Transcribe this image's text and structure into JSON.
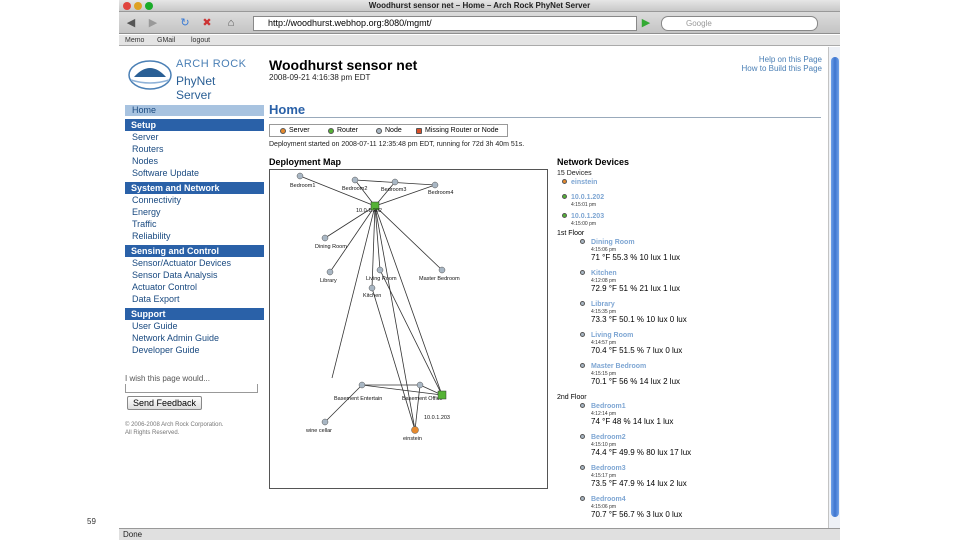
{
  "window": {
    "title": "Woodhurst sensor net – Home – Arch Rock PhyNet Server"
  },
  "toolbar": {
    "url": "http://woodhurst.webhop.org:8080/mgmt/",
    "search_placeholder": "Google"
  },
  "bookmarks": [
    "Memo",
    "GMail",
    "logout"
  ],
  "logo": {
    "line1": "ARCH ROCK",
    "line2": "PhyNet Server"
  },
  "header": {
    "title": "Woodhurst sensor net",
    "date": "2008-09-21 4:16:38 pm EDT",
    "help_links": [
      "Help on this Page",
      "How to Build this Page"
    ]
  },
  "nav": {
    "home": "Home",
    "sections": [
      {
        "title": "Setup",
        "items": [
          "Server",
          "Routers",
          "Nodes",
          "Software Update"
        ]
      },
      {
        "title": "System and Network",
        "items": [
          "Connectivity",
          "Energy",
          "Traffic",
          "Reliability"
        ]
      },
      {
        "title": "Sensing and Control",
        "items": [
          "Sensor/Actuator Devices",
          "Sensor Data Analysis",
          "Actuator Control",
          "Data Export"
        ]
      },
      {
        "title": "Support",
        "items": [
          "User Guide",
          "Network Admin Guide",
          "Developer Guide"
        ]
      }
    ]
  },
  "feedback": {
    "label": "I wish this page would...",
    "button": "Send Feedback"
  },
  "copyright": [
    "© 2006-2008 Arch Rock Corporation.",
    "All Rights Reserved."
  ],
  "main": {
    "title": "Home",
    "legend": [
      "Server",
      "Router",
      "Node",
      "Missing Router or Node"
    ],
    "deployment_info": "Deployment started on 2008-07-11 12:35:48 pm EDT, running for 72d 3h 40m 51s.",
    "map_title": "Deployment Map",
    "map_labels": {
      "bedroom1": "Bedroom1",
      "bedroom2": "Bedroom2",
      "bedroom3": "Bedroom3",
      "bedroom4": "Bedroom4",
      "router": "10.0.1.202",
      "dining": "Dining Room",
      "library": "Library",
      "living": "Living Room",
      "master": "Master Bedroom",
      "kitchen": "Kitchen",
      "basement": "Basement Entertain",
      "office": "Basement Office",
      "wine": "wine cellar",
      "einstein": "einstein",
      "router2": "10.0.1.203"
    }
  },
  "devices": {
    "title": "Network Devices",
    "count": "15 Devices",
    "gateways": [
      {
        "name": "einstein",
        "time": "",
        "color": "#e68a2e"
      },
      {
        "name": "10.0.1.202",
        "time": "4:15:01 pm",
        "color": "#55b235"
      },
      {
        "name": "10.0.1.203",
        "time": "4:15:00 pm",
        "color": "#55b235"
      }
    ],
    "floors": [
      {
        "name": "1st Floor",
        "sensors": [
          {
            "name": "Dining Room",
            "time": "4:15:06 pm",
            "values": "71 °F   55.3 %   10 lux   1 lux"
          },
          {
            "name": "Kitchen",
            "time": "4:12:08 pm",
            "values": "72.9 °F   51 %   21 lux   1 lux"
          },
          {
            "name": "Library",
            "time": "4:15:35 pm",
            "values": "73.3 °F   50.1 %   10 lux   0 lux"
          },
          {
            "name": "Living Room",
            "time": "4:14:57 pm",
            "values": "70.4 °F   51.5 %   7 lux   0 lux"
          },
          {
            "name": "Master Bedroom",
            "time": "4:15:15 pm",
            "values": "70.1 °F   56 %   14 lux   2 lux"
          }
        ]
      },
      {
        "name": "2nd Floor",
        "sensors": [
          {
            "name": "Bedroom1",
            "time": "4:12:14 pm",
            "values": "74 °F   48 %   14 lux   1 lux"
          },
          {
            "name": "Bedroom2",
            "time": "4:15:10 pm",
            "values": "74.4 °F   49.9 %   80 lux   17 lux"
          },
          {
            "name": "Bedroom3",
            "time": "4:15:17 pm",
            "values": "73.5 °F   47.9 %   14 lux   2 lux"
          },
          {
            "name": "Bedroom4",
            "time": "4:15:06 pm",
            "values": "70.7 °F   56.7 %   3 lux   0 lux"
          }
        ]
      }
    ]
  },
  "status": {
    "text": "Done"
  },
  "slide_number": "59"
}
